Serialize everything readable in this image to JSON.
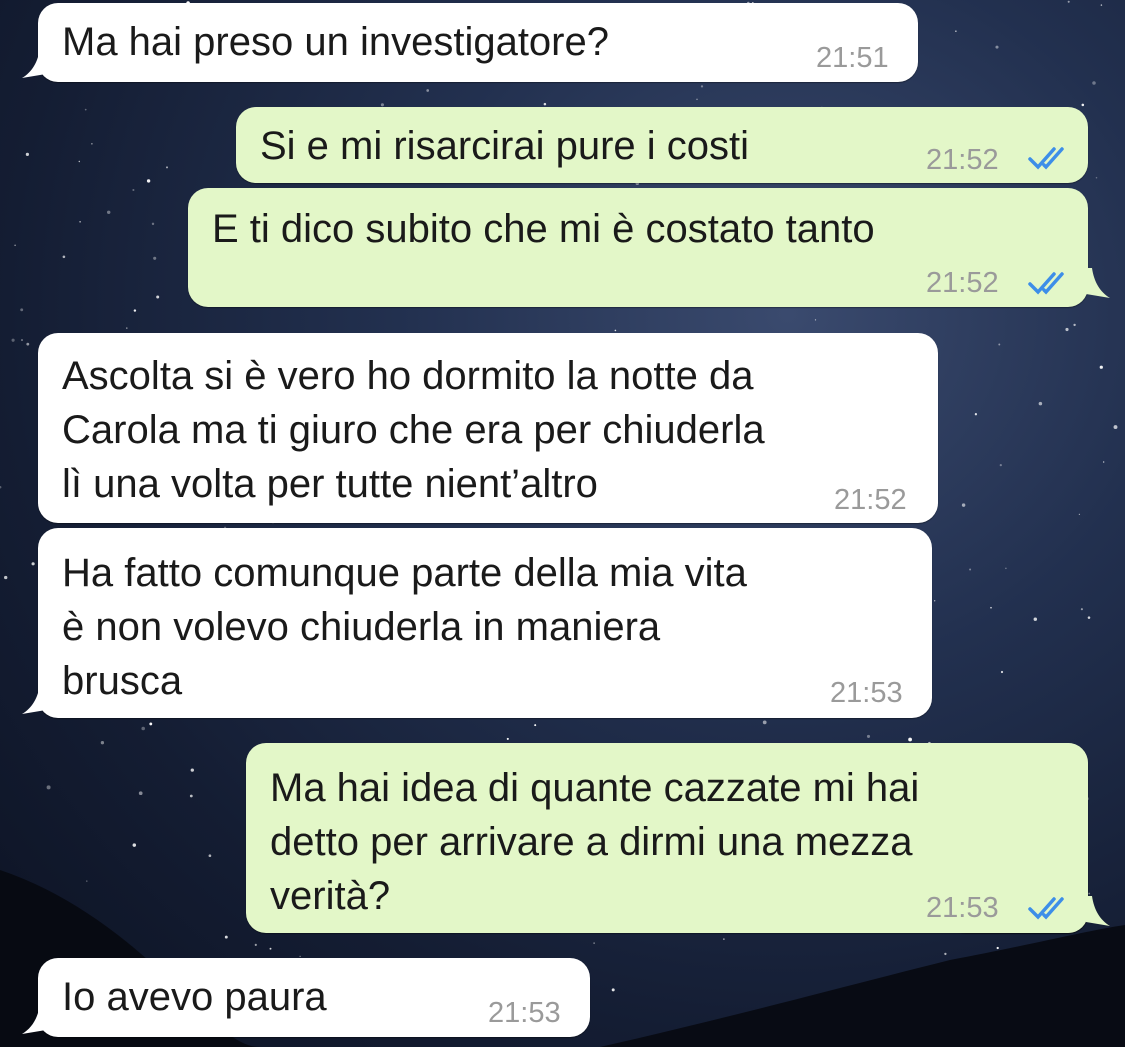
{
  "chat": {
    "messages": [
      {
        "direction": "incoming",
        "text": "Ma hai preso un investigatore?",
        "time": "21:51"
      },
      {
        "direction": "outgoing",
        "text": "Si e mi risarcirai pure i costi",
        "time": "21:52",
        "status": "read"
      },
      {
        "direction": "outgoing",
        "text": "E ti dico subito che mi è costato tanto",
        "time": "21:52",
        "status": "read"
      },
      {
        "direction": "incoming",
        "lines": [
          "Ascolta si è vero ho dormito la notte da",
          "Carola ma ti giuro che era per chiuderla",
          "lì una volta per tutte nient’altro"
        ],
        "time": "21:52"
      },
      {
        "direction": "incoming",
        "lines": [
          "Ha fatto comunque parte della mia vita",
          "è non volevo chiuderla in maniera",
          "brusca"
        ],
        "time": "21:53"
      },
      {
        "direction": "outgoing",
        "lines": [
          "Ma hai idea di quante cazzate mi hai",
          "detto per arrivare a dirmi una mezza",
          "verità?"
        ],
        "time": "21:53",
        "status": "read"
      },
      {
        "direction": "incoming",
        "text": "Io avevo paura",
        "time": "21:53"
      }
    ]
  },
  "colors": {
    "incoming_bubble": "#ffffff",
    "outgoing_bubble": "#e3f7c8",
    "read_ticks": "#3d8ee8",
    "timestamp": "#9a9a9a"
  },
  "icons": {
    "read_receipt": "double-check-icon"
  }
}
